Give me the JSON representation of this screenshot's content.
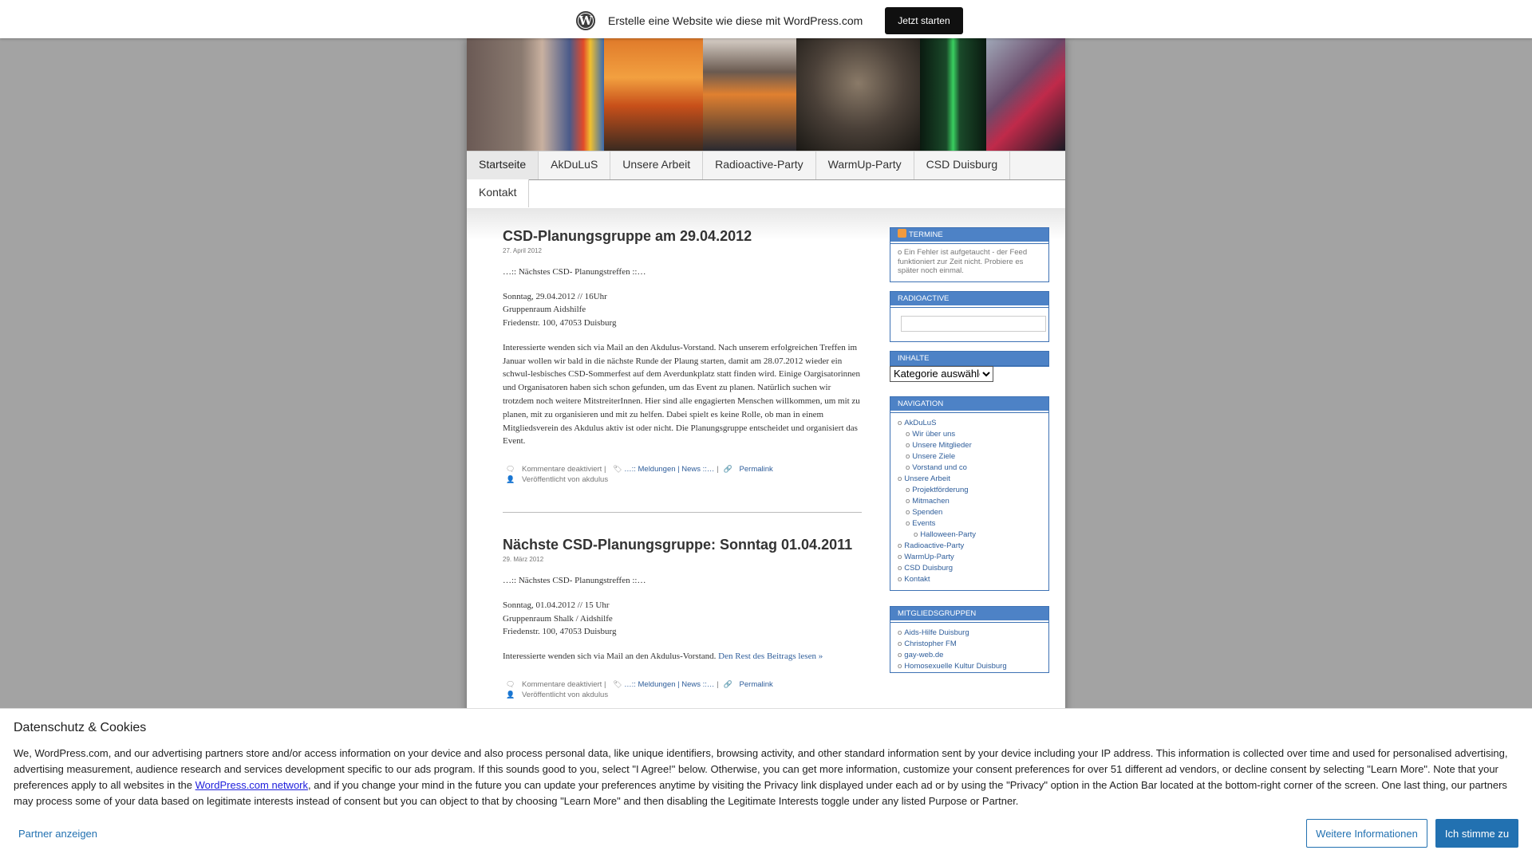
{
  "topbar": {
    "logo_letter": "W",
    "promo": "Erstelle eine Website wie diese mit WordPress.com",
    "start_button": "Jetzt starten"
  },
  "header_photos": [
    "#5a4a4a",
    "#c8622a",
    "#3a3a3a",
    "#4a4038",
    "#1e3a2a",
    "#6a3a4a"
  ],
  "nav": {
    "row1": [
      "Startseite",
      "AkDuLuS",
      "Unsere Arbeit",
      "Radioactive-Party",
      "WarmUp-Party",
      "CSD Duisburg"
    ],
    "row2": [
      "Kontakt"
    ]
  },
  "posts": [
    {
      "title": "CSD-Planungsgruppe am 29.04.2012",
      "date": "27. April 2012",
      "p1": "…:: Nächstes CSD- Planungstreffen ::…",
      "p2_lines": [
        "Sonntag, 29.04.2012 // 16Uhr",
        "Gruppenraum  Aidshilfe",
        "Friedenstr. 100, 47053 Duisburg"
      ],
      "p3": "Interessierte wenden sich via Mail an den Akdulus-Vorstand.     Nach unserem erfolgreichen Treffen im Januar wollen wir bald in die nächste Runde der Plaung starten, damit am 28.07.2012 wieder ein schwul-lesbisches CSD-Sommerfest auf dem Averdunkplatz statt finden wird. Einige Oargisatorinnen und Organisatoren haben sich schon gefunden, um  das Event zu planen. Natürlich suchen wir trotzdem noch weitere MitstreiterInnen. Hier sind alle engagierten Menschen willkommen, um mit zu planen, mit zu organisieren und mit zu helfen. Dabei spielt es keine Rolle, ob man in einem Mitgliedsverein des Akdulus aktiv ist oder nicht. Die Planungsgruppe entscheidet und organisiert das Event.",
      "more": "",
      "comments": "Kommentare deaktiviert |",
      "categories": "…:: Meldungen | News ::…",
      "cat_sep": "|",
      "permalink": "Permalink",
      "author": "Veröffentlicht von akdulus"
    },
    {
      "title": "Nächste CSD-Planungsgruppe: Sonntag 01.04.2011",
      "date": "29. März 2012",
      "p1": "…:: Nächstes CSD- Planungstreffen ::…",
      "p2_lines": [
        "Sonntag, 01.04.2012 // 15 Uhr",
        "Gruppenraum Shalk / Aidshilfe",
        "Friedenstr. 100, 47053 Duisburg"
      ],
      "p3": "Interessierte wenden sich via Mail an den Akdulus-Vorstand.",
      "more": "Den Rest des Beitrags lesen »",
      "comments": "Kommentare deaktiviert |",
      "categories": "…:: Meldungen | News ::…",
      "cat_sep": "|",
      "permalink": "Permalink",
      "author": "Veröffentlicht von akdulus"
    }
  ],
  "sidebar": {
    "termine": {
      "title": "TERMINE",
      "text": "o Ein Fehler ist aufgetaucht - der Feed funktioniert zur Zeit nicht. Probiere es später noch einmal."
    },
    "radioactive": {
      "title": "RADIOACTIVE"
    },
    "inhalte": {
      "title": "INHALTE",
      "select": "Kategorie auswählen"
    },
    "navigation": {
      "title": "NAVIGATION",
      "items": [
        {
          "label": "AkDuLuS",
          "level": 1
        },
        {
          "label": "Wir über uns",
          "level": 2
        },
        {
          "label": "Unsere Mitglieder",
          "level": 2
        },
        {
          "label": "Unsere Ziele",
          "level": 2
        },
        {
          "label": "Vorstand und co",
          "level": 2
        },
        {
          "label": "Unsere Arbeit",
          "level": 1
        },
        {
          "label": "Projektförderung",
          "level": 2
        },
        {
          "label": "Mitmachen",
          "level": 2
        },
        {
          "label": "Spenden",
          "level": 2
        },
        {
          "label": "Events",
          "level": 2
        },
        {
          "label": "Halloween-Party",
          "level": 3
        },
        {
          "label": "Radioactive-Party",
          "level": 1
        },
        {
          "label": "WarmUp-Party",
          "level": 1
        },
        {
          "label": "CSD Duisburg",
          "level": 1
        },
        {
          "label": "Kontakt",
          "level": 1
        }
      ]
    },
    "mitgliedsgruppen": {
      "title": "MITGLIEDSGRUPPEN",
      "items": [
        "Aids-Hilfe Duisburg",
        "Christopher FM",
        "gay-web.de",
        "Homosexuelle Kultur Duisburg"
      ]
    }
  },
  "cookie": {
    "title": "Datenschutz & Cookies",
    "text_before_link": "We, WordPress.com, and our advertising partners store and/or access information on your device and also process personal data, like unique identifiers, browsing activity, and other standard information sent by your device including your IP address. This information is collected over time and used for personalised advertising, advertising measurement, audience research and services development specific to our ads program. If this sounds good to you, select \"I Agree!\" below. Otherwise, you can get more information, customize your consent preferences for over 51 different ad vendors, or decline consent by selecting \"Learn More\". Note that your preferences apply to all websites in the ",
    "link": "WordPress.com network",
    "text_after_link": ", and if you change your mind in the future you can update your preferences anytime by visiting the Privacy link displayed under each ad or by using the \"Privacy\" option in the Action Bar located at the bottom-right corner of the screen. One last thing, our partners may process some of your data based on legitimate interests instead of consent but you can object to that by choosing \"Learn More\" and then disabling the Legitimate Interests toggle under any listed Purpose or Partner.",
    "partners": "Partner anzeigen",
    "learn_more": "Weitere Informationen",
    "agree": "Ich stimme zu"
  }
}
